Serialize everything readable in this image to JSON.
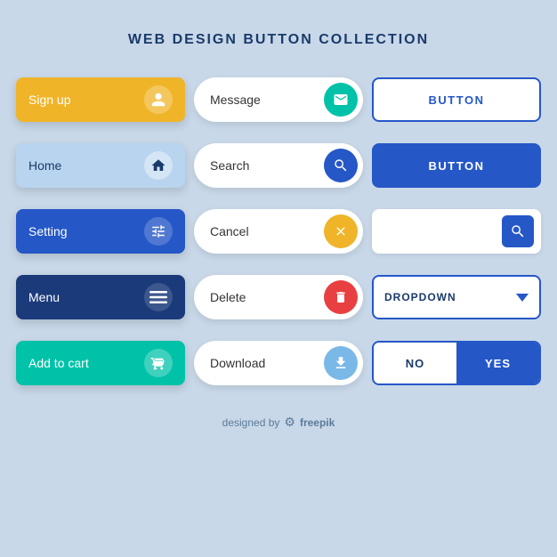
{
  "title": "WEB DESIGN BUTTON COLLECTION",
  "col1": {
    "signup": "Sign up",
    "home": "Home",
    "setting": "Setting",
    "menu": "Menu",
    "addtocart": "Add to cart"
  },
  "col2": {
    "message": "Message",
    "search": "Search",
    "cancel": "Cancel",
    "delete": "Delete",
    "download": "Download"
  },
  "col3": {
    "button1": "BUTTON",
    "button2": "BUTTON",
    "dropdown": "DROPDOWN",
    "no": "NO",
    "yes": "YES"
  },
  "footer": {
    "label": "designed by",
    "brand": "freepik"
  }
}
